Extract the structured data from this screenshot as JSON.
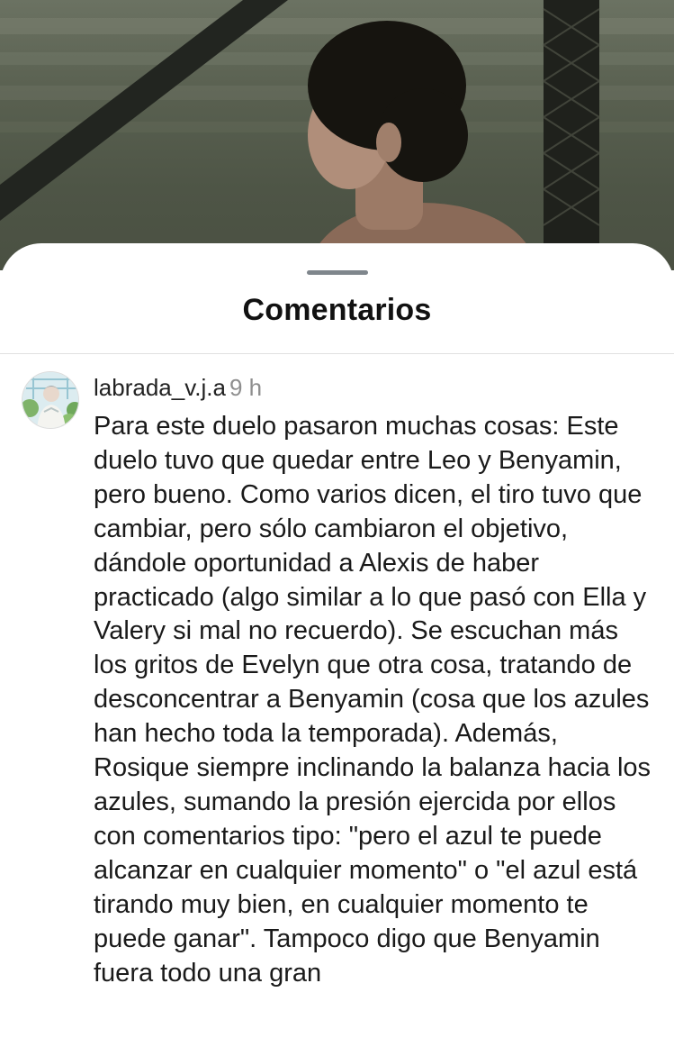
{
  "sheet": {
    "title": "Comentarios"
  },
  "comment": {
    "username": "labrada_v.j.a",
    "time_ago": "9 h",
    "text": "Para este duelo pasaron muchas cosas: Este duelo tuvo que quedar entre Leo y Benyamin, pero bueno. Como varios dicen, el tiro tuvo que cambiar, pero sólo cambiaron el objetivo, dándole oportunidad a Alexis de haber practicado (algo similar a lo que pasó con Ella y Valery si mal no recuerdo). Se escuchan más los gritos de Evelyn que otra cosa, tratando de desconcentrar a Benyamin (cosa que los azules han hecho toda la temporada). Además, Rosique siempre inclinando la balanza hacia los azules, sumando la presión ejercida por ellos con comentarios tipo: \"pero el azul te puede alcanzar en cualquier momento\" o \"el azul está tirando muy bien, en cualquier momento te puede ganar\". Tampoco digo que Benyamin fuera todo una gran"
  },
  "icons": {
    "avatar": "user-avatar-image"
  }
}
